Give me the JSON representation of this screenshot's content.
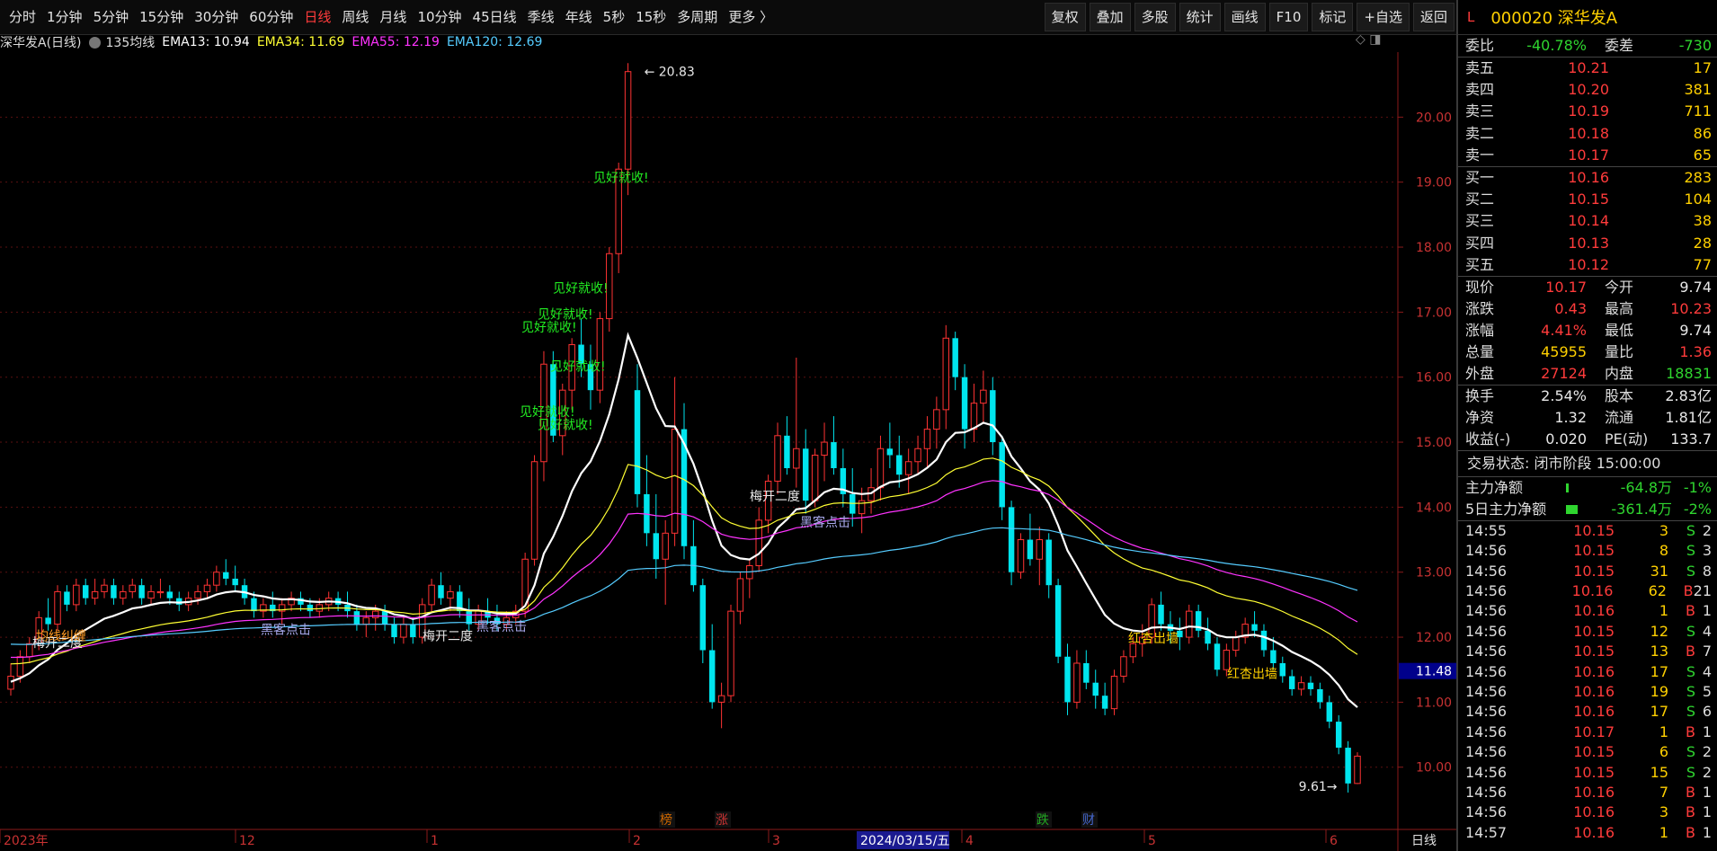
{
  "toolbar": {
    "periods": [
      "分时",
      "1分钟",
      "5分钟",
      "15分钟",
      "30分钟",
      "60分钟",
      "日线",
      "周线",
      "月线",
      "10分钟",
      "45日线",
      "季线",
      "年线",
      "5秒",
      "15秒",
      "多周期",
      "更多 〉"
    ],
    "active_period": "日线",
    "actions": [
      "复权",
      "叠加",
      "多股",
      "统计",
      "画线",
      "F10",
      "标记",
      "+自选",
      "返回"
    ]
  },
  "legend": {
    "title": "深华发A(日线)",
    "ma_label": "135均线",
    "ema13": "EMA13: 10.94",
    "ema34": "EMA34: 11.69",
    "ema55": "EMA55: 12.19",
    "ema120": "EMA120: 12.69",
    "colors": {
      "ema13": "#ffffff",
      "ema34": "#ffff33",
      "ema55": "#ff33ff",
      "ema120": "#55ccff"
    }
  },
  "chart_data": {
    "type": "candlestick",
    "ylim": [
      9.25,
      21.0
    ],
    "y_ticks": [
      "20.00",
      "19.00",
      "18.00",
      "17.00",
      "16.00",
      "15.00",
      "14.00",
      "13.00",
      "12.00",
      "11.00",
      "10.00"
    ],
    "current_price_tag": "11.48",
    "high_label": "20.83",
    "low_label": "9.61",
    "x_labels": [
      "2023年",
      "12",
      "1",
      "2",
      "3",
      "4",
      "5",
      "6"
    ],
    "selected_date": "2024/03/15/五",
    "period_label": "日线",
    "event_markers": [
      "榜",
      "涨",
      "跌",
      "财"
    ],
    "annotations": [
      {
        "text": "见好就收!",
        "color": "#22ee22",
        "price": 19.0
      },
      {
        "text": "见好就收!",
        "color": "#22ee22",
        "price": 17.3
      },
      {
        "text": "见好就收!",
        "color": "#22ee22",
        "price": 16.9
      },
      {
        "text": "见好就收!",
        "color": "#22ee22",
        "price": 16.7
      },
      {
        "text": "见好就收!",
        "color": "#22ee22",
        "price": 16.1
      },
      {
        "text": "见好就收!",
        "color": "#22ee22",
        "price": 15.4
      },
      {
        "text": "见好就收!",
        "color": "#22ee22",
        "price": 15.2
      },
      {
        "text": "梅开二度",
        "color": "#e8e8e8",
        "price": 11.85
      },
      {
        "text": "均线纠缠",
        "color": "#ff9a22",
        "price": 11.95
      },
      {
        "text": "黑客点击",
        "color": "#aaaaee",
        "price": 12.05
      },
      {
        "text": "梅开二度",
        "color": "#e8e8e8",
        "price": 11.95
      },
      {
        "text": "黑客点击",
        "color": "#aaaaee",
        "price": 12.1
      },
      {
        "text": "梅开二度",
        "color": "#e8e8e8",
        "price": 14.1
      },
      {
        "text": "黑客点击",
        "color": "#aaaaee",
        "price": 13.7
      },
      {
        "text": "红杏出墙",
        "color": "#ffd000",
        "price": 11.92
      },
      {
        "text": "红杏出墙",
        "color": "#ffd000",
        "price": 11.37
      }
    ],
    "candles": [
      [
        11.2,
        11.6,
        11.1,
        11.4
      ],
      [
        11.4,
        11.8,
        11.3,
        11.7
      ],
      [
        11.7,
        12.0,
        11.6,
        11.9
      ],
      [
        11.9,
        12.4,
        11.8,
        12.3
      ],
      [
        12.3,
        12.6,
        12.1,
        12.2
      ],
      [
        12.2,
        12.8,
        12.1,
        12.7
      ],
      [
        12.7,
        12.8,
        12.4,
        12.5
      ],
      [
        12.5,
        12.9,
        12.4,
        12.8
      ],
      [
        12.8,
        12.9,
        12.5,
        12.6
      ],
      [
        12.6,
        12.9,
        12.5,
        12.7
      ],
      [
        12.7,
        12.9,
        12.6,
        12.8
      ],
      [
        12.8,
        12.9,
        12.5,
        12.6
      ],
      [
        12.6,
        12.8,
        12.5,
        12.7
      ],
      [
        12.7,
        12.9,
        12.6,
        12.8
      ],
      [
        12.8,
        12.9,
        12.5,
        12.6
      ],
      [
        12.6,
        12.8,
        12.5,
        12.7
      ],
      [
        12.7,
        12.9,
        12.6,
        12.7
      ],
      [
        12.7,
        12.8,
        12.5,
        12.6
      ],
      [
        12.6,
        12.7,
        12.4,
        12.5
      ],
      [
        12.5,
        12.7,
        12.4,
        12.6
      ],
      [
        12.6,
        12.8,
        12.5,
        12.7
      ],
      [
        12.7,
        12.9,
        12.6,
        12.8
      ],
      [
        12.8,
        13.1,
        12.7,
        13.0
      ],
      [
        13.0,
        13.2,
        12.8,
        12.9
      ],
      [
        12.9,
        13.1,
        12.7,
        12.8
      ],
      [
        12.8,
        12.9,
        12.5,
        12.6
      ],
      [
        12.6,
        12.7,
        12.3,
        12.4
      ],
      [
        12.4,
        12.6,
        12.3,
        12.5
      ],
      [
        12.5,
        12.7,
        12.3,
        12.4
      ],
      [
        12.4,
        12.6,
        12.2,
        12.5
      ],
      [
        12.5,
        12.7,
        12.4,
        12.6
      ],
      [
        12.6,
        12.7,
        12.4,
        12.5
      ],
      [
        12.5,
        12.6,
        12.3,
        12.4
      ],
      [
        12.4,
        12.6,
        12.3,
        12.5
      ],
      [
        12.5,
        12.7,
        12.4,
        12.6
      ],
      [
        12.6,
        12.7,
        12.4,
        12.5
      ],
      [
        12.5,
        12.7,
        12.3,
        12.4
      ],
      [
        12.4,
        12.5,
        12.1,
        12.2
      ],
      [
        12.2,
        12.4,
        12.0,
        12.3
      ],
      [
        12.3,
        12.5,
        12.1,
        12.4
      ],
      [
        12.4,
        12.5,
        12.1,
        12.2
      ],
      [
        12.2,
        12.3,
        11.9,
        12.0
      ],
      [
        12.0,
        12.3,
        11.9,
        12.2
      ],
      [
        12.2,
        12.3,
        11.9,
        12.0
      ],
      [
        12.0,
        12.6,
        11.9,
        12.5
      ],
      [
        12.5,
        12.9,
        12.4,
        12.8
      ],
      [
        12.8,
        13.0,
        12.5,
        12.6
      ],
      [
        12.6,
        12.8,
        12.4,
        12.7
      ],
      [
        12.7,
        12.8,
        12.3,
        12.4
      ],
      [
        12.4,
        12.6,
        12.1,
        12.2
      ],
      [
        12.2,
        12.5,
        12.1,
        12.4
      ],
      [
        12.4,
        12.6,
        12.2,
        12.3
      ],
      [
        12.3,
        12.5,
        12.1,
        12.2
      ],
      [
        12.2,
        12.4,
        12.1,
        12.3
      ],
      [
        12.3,
        12.5,
        12.2,
        12.4
      ],
      [
        12.4,
        13.3,
        12.3,
        13.2
      ],
      [
        13.2,
        14.8,
        13.1,
        14.7
      ],
      [
        14.7,
        16.4,
        14.4,
        16.2
      ],
      [
        16.2,
        16.4,
        15.0,
        15.1
      ],
      [
        15.1,
        15.9,
        14.8,
        15.8
      ],
      [
        15.8,
        16.6,
        15.5,
        16.5
      ],
      [
        16.5,
        16.9,
        16.0,
        16.2
      ],
      [
        16.2,
        16.5,
        15.5,
        15.8
      ],
      [
        15.8,
        17.0,
        15.6,
        16.9
      ],
      [
        16.9,
        18.0,
        16.7,
        17.9
      ],
      [
        17.9,
        19.3,
        17.6,
        19.2
      ],
      [
        19.2,
        20.83,
        18.8,
        20.7
      ],
      [
        15.8,
        16.2,
        14.0,
        14.2
      ],
      [
        14.2,
        14.8,
        13.4,
        13.6
      ],
      [
        13.6,
        14.2,
        12.9,
        13.2
      ],
      [
        13.2,
        13.8,
        12.5,
        13.6
      ],
      [
        13.6,
        16.0,
        13.4,
        15.2
      ],
      [
        15.2,
        15.6,
        13.2,
        13.4
      ],
      [
        13.4,
        13.8,
        12.7,
        12.8
      ],
      [
        12.8,
        12.9,
        11.6,
        11.8
      ],
      [
        11.8,
        12.2,
        10.9,
        11.0
      ],
      [
        11.0,
        11.3,
        10.6,
        11.1
      ],
      [
        11.1,
        12.5,
        11.0,
        12.4
      ],
      [
        12.4,
        13.0,
        12.2,
        12.9
      ],
      [
        12.9,
        13.2,
        12.6,
        13.1
      ],
      [
        13.1,
        14.0,
        13.0,
        13.8
      ],
      [
        13.8,
        14.5,
        13.6,
        14.4
      ],
      [
        14.4,
        15.3,
        14.2,
        15.1
      ],
      [
        15.1,
        15.4,
        14.5,
        14.6
      ],
      [
        14.6,
        16.3,
        14.3,
        14.9
      ],
      [
        14.9,
        15.2,
        13.9,
        14.1
      ],
      [
        14.1,
        14.9,
        14.0,
        14.8
      ],
      [
        14.8,
        15.3,
        14.4,
        15.0
      ],
      [
        15.0,
        15.4,
        14.5,
        14.6
      ],
      [
        14.6,
        14.9,
        14.0,
        14.2
      ],
      [
        14.2,
        14.6,
        13.7,
        13.9
      ],
      [
        13.9,
        14.3,
        13.6,
        14.1
      ],
      [
        14.1,
        14.6,
        13.9,
        14.3
      ],
      [
        14.3,
        15.1,
        14.1,
        14.9
      ],
      [
        14.9,
        15.3,
        14.6,
        14.8
      ],
      [
        14.8,
        15.1,
        14.3,
        14.5
      ],
      [
        14.5,
        14.9,
        14.2,
        14.7
      ],
      [
        14.7,
        15.1,
        14.5,
        14.9
      ],
      [
        14.9,
        15.4,
        14.6,
        15.2
      ],
      [
        15.2,
        15.7,
        14.9,
        15.5
      ],
      [
        15.5,
        16.8,
        15.2,
        16.6
      ],
      [
        16.6,
        16.7,
        15.8,
        16.0
      ],
      [
        16.0,
        16.2,
        14.9,
        15.2
      ],
      [
        15.2,
        15.9,
        15.0,
        15.6
      ],
      [
        15.6,
        16.1,
        15.3,
        15.8
      ],
      [
        15.8,
        16.0,
        14.8,
        15.0
      ],
      [
        15.0,
        15.1,
        13.8,
        14.0
      ],
      [
        14.0,
        14.1,
        12.8,
        13.0
      ],
      [
        13.0,
        13.6,
        12.9,
        13.5
      ],
      [
        13.5,
        13.9,
        13.1,
        13.2
      ],
      [
        13.2,
        13.7,
        12.8,
        13.5
      ],
      [
        13.5,
        13.6,
        12.6,
        12.8
      ],
      [
        12.8,
        12.9,
        11.6,
        11.7
      ],
      [
        11.7,
        11.9,
        10.8,
        11.0
      ],
      [
        11.0,
        11.8,
        10.9,
        11.6
      ],
      [
        11.6,
        11.8,
        11.2,
        11.3
      ],
      [
        11.3,
        11.5,
        10.9,
        11.1
      ],
      [
        11.1,
        11.3,
        10.8,
        10.9
      ],
      [
        10.9,
        11.5,
        10.8,
        11.4
      ],
      [
        11.4,
        11.8,
        11.3,
        11.7
      ],
      [
        11.7,
        12.0,
        11.6,
        11.9
      ],
      [
        11.9,
        12.2,
        11.7,
        12.0
      ],
      [
        12.0,
        12.6,
        11.9,
        12.5
      ],
      [
        12.5,
        12.7,
        12.1,
        12.2
      ],
      [
        12.2,
        12.4,
        11.9,
        12.1
      ],
      [
        12.1,
        12.3,
        11.8,
        12.0
      ],
      [
        12.0,
        12.5,
        11.9,
        12.4
      ],
      [
        12.4,
        12.5,
        12.0,
        12.1
      ],
      [
        12.1,
        12.3,
        11.8,
        11.9
      ],
      [
        11.9,
        12.0,
        11.4,
        11.5
      ],
      [
        11.5,
        11.9,
        11.4,
        11.8
      ],
      [
        11.8,
        12.1,
        11.7,
        12.0
      ],
      [
        12.0,
        12.3,
        11.9,
        12.2
      ],
      [
        12.2,
        12.4,
        12.0,
        12.1
      ],
      [
        12.1,
        12.2,
        11.7,
        11.8
      ],
      [
        11.8,
        12.0,
        11.5,
        11.6
      ],
      [
        11.6,
        11.7,
        11.3,
        11.4
      ],
      [
        11.4,
        11.5,
        11.1,
        11.2
      ],
      [
        11.2,
        11.4,
        11.1,
        11.3
      ],
      [
        11.3,
        11.4,
        11.1,
        11.2
      ],
      [
        11.2,
        11.3,
        10.9,
        11.0
      ],
      [
        11.0,
        11.1,
        10.6,
        10.7
      ],
      [
        10.7,
        10.8,
        10.2,
        10.3
      ],
      [
        10.3,
        10.4,
        9.61,
        9.75
      ],
      [
        9.75,
        10.23,
        9.74,
        10.17
      ]
    ]
  },
  "panel": {
    "mark": "L",
    "title": "000020 深华发A",
    "weibi": {
      "label1": "委比",
      "v1": "-40.78%",
      "label2": "委差",
      "v2": "-730"
    },
    "sell": [
      {
        "label": "卖五",
        "price": "10.21",
        "vol": "17"
      },
      {
        "label": "卖四",
        "price": "10.20",
        "vol": "381"
      },
      {
        "label": "卖三",
        "price": "10.19",
        "vol": "711"
      },
      {
        "label": "卖二",
        "price": "10.18",
        "vol": "86"
      },
      {
        "label": "卖一",
        "price": "10.17",
        "vol": "65"
      }
    ],
    "buy": [
      {
        "label": "买一",
        "price": "10.16",
        "vol": "283"
      },
      {
        "label": "买二",
        "price": "10.15",
        "vol": "104"
      },
      {
        "label": "买三",
        "price": "10.14",
        "vol": "38"
      },
      {
        "label": "买四",
        "price": "10.13",
        "vol": "28"
      },
      {
        "label": "买五",
        "price": "10.12",
        "vol": "77"
      }
    ],
    "stats": [
      {
        "l1": "现价",
        "v1": "10.17",
        "c1": "red",
        "l2": "今开",
        "v2": "9.74",
        "c2": "white"
      },
      {
        "l1": "涨跌",
        "v1": "0.43",
        "c1": "red",
        "l2": "最高",
        "v2": "10.23",
        "c2": "red"
      },
      {
        "l1": "涨幅",
        "v1": "4.41%",
        "c1": "red",
        "l2": "最低",
        "v2": "9.74",
        "c2": "white"
      },
      {
        "l1": "总量",
        "v1": "45955",
        "c1": "yellow",
        "l2": "量比",
        "v2": "1.36",
        "c2": "red"
      },
      {
        "l1": "外盘",
        "v1": "27124",
        "c1": "red",
        "l2": "内盘",
        "v2": "18831",
        "c2": "green"
      }
    ],
    "stats2": [
      {
        "l1": "换手",
        "v1": "2.54%",
        "l2": "股本",
        "v2": "2.83亿"
      },
      {
        "l1": "净资",
        "v1": "1.32",
        "l2": "流通",
        "v2": "1.81亿"
      },
      {
        "l1": "收益(-)",
        "v1": "0.020",
        "l2": "PE(动)",
        "v2": "133.7"
      }
    ],
    "trade_status": "交易状态: 闭市阶段 15:00:00",
    "flows": [
      {
        "label": "主力净额",
        "value": "-64.8万",
        "pct": "-1%",
        "bar_fraction": 0.06
      },
      {
        "label": "5日主力净额",
        "value": "-361.4万",
        "pct": "-2%",
        "bar_fraction": 0.42
      }
    ],
    "ticks": [
      {
        "t": "14:55",
        "p": "10.15",
        "pc": "red",
        "v": "3",
        "d": "S",
        "n": "2"
      },
      {
        "t": "14:56",
        "p": "10.15",
        "pc": "red",
        "v": "8",
        "d": "S",
        "n": "3"
      },
      {
        "t": "14:56",
        "p": "10.15",
        "pc": "red",
        "v": "31",
        "d": "S",
        "n": "8"
      },
      {
        "t": "14:56",
        "p": "10.16",
        "pc": "red",
        "v": "62",
        "d": "B",
        "n": "21"
      },
      {
        "t": "14:56",
        "p": "10.16",
        "pc": "red",
        "v": "1",
        "d": "B",
        "n": "1"
      },
      {
        "t": "14:56",
        "p": "10.15",
        "pc": "red",
        "v": "12",
        "d": "S",
        "n": "4"
      },
      {
        "t": "14:56",
        "p": "10.15",
        "pc": "red",
        "v": "13",
        "d": "B",
        "n": "7"
      },
      {
        "t": "14:56",
        "p": "10.16",
        "pc": "red",
        "v": "17",
        "d": "S",
        "n": "4"
      },
      {
        "t": "14:56",
        "p": "10.16",
        "pc": "red",
        "v": "19",
        "d": "S",
        "n": "5"
      },
      {
        "t": "14:56",
        "p": "10.16",
        "pc": "red",
        "v": "17",
        "d": "S",
        "n": "6"
      },
      {
        "t": "14:56",
        "p": "10.17",
        "pc": "red",
        "v": "1",
        "d": "B",
        "n": "1"
      },
      {
        "t": "14:56",
        "p": "10.15",
        "pc": "red",
        "v": "6",
        "d": "S",
        "n": "2"
      },
      {
        "t": "14:56",
        "p": "10.15",
        "pc": "red",
        "v": "15",
        "d": "S",
        "n": "2"
      },
      {
        "t": "14:56",
        "p": "10.16",
        "pc": "red",
        "v": "7",
        "d": "B",
        "n": "1"
      },
      {
        "t": "14:56",
        "p": "10.16",
        "pc": "red",
        "v": "3",
        "d": "B",
        "n": "1"
      },
      {
        "t": "14:57",
        "p": "10.16",
        "pc": "red",
        "v": "1",
        "d": "B",
        "n": "1"
      }
    ]
  }
}
